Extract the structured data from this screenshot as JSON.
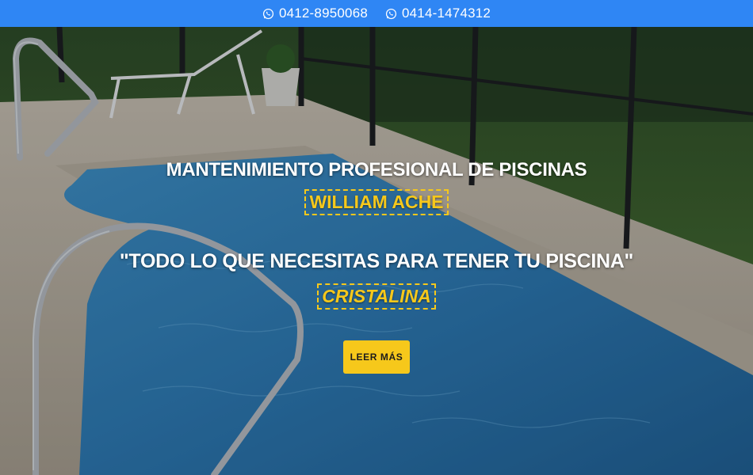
{
  "topbar": {
    "phones": [
      {
        "icon": "whatsapp-icon",
        "number": "0412-8950068"
      },
      {
        "icon": "whatsapp-icon",
        "number": "0414-1474312"
      }
    ],
    "background": "#2f86f4"
  },
  "hero": {
    "title": "MANTENIMIENTO PROFESIONAL DE PISCINAS",
    "name": "WILLIAM ACHE",
    "slogan": "\"TODO LO QUE NECESITAS PARA TENER TU PISCINA\"",
    "accent": "CRISTALINA",
    "cta_label": "LEER MÁS",
    "accent_color": "#f6c81b"
  }
}
